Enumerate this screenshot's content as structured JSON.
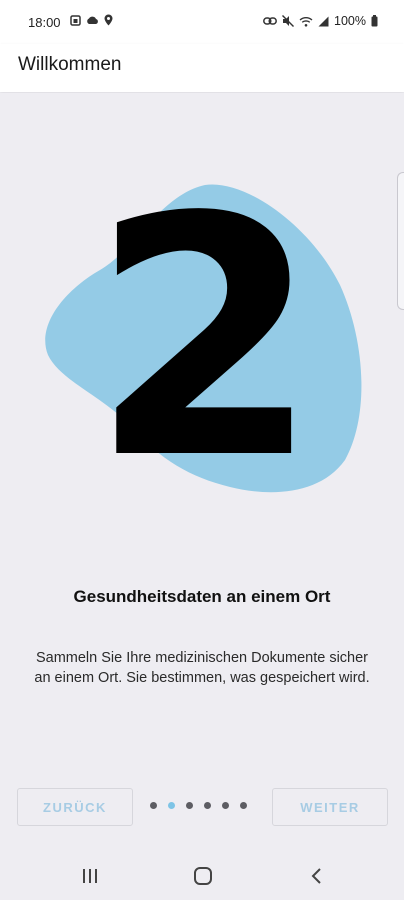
{
  "status_bar": {
    "time": "18:00",
    "battery": "100%",
    "icons_left": [
      "photo-icon",
      "cloud-icon",
      "location-icon"
    ],
    "icons_right": [
      "link-icon",
      "mute-icon",
      "wifi-icon",
      "signal-icon",
      "battery-icon"
    ]
  },
  "app_bar": {
    "title": "Willkommen"
  },
  "onboarding": {
    "step_number": "2",
    "headline": "Gesundheitsdaten an einem Ort",
    "description": "Sammeln Sie Ihre medizinischen Dokumente sicher an einem Ort. Sie bestimmen, was gespeichert wird.",
    "blob_color": "#94cbe6",
    "pages_total": 6,
    "current_page": 2
  },
  "controls": {
    "back_label": "ZURÜCK",
    "next_label": "WEITER",
    "button_text_color": "#a7cce4"
  },
  "nav_bar": {
    "icons": [
      "recent-apps-icon",
      "home-icon",
      "back-icon"
    ]
  }
}
